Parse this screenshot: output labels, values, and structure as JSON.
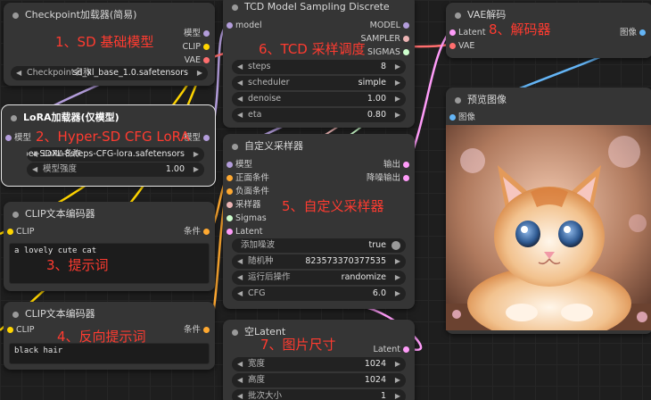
{
  "colors": {
    "clip": "#ffd500",
    "model": "#b39ddb",
    "vae": "#ff6e6e",
    "latent": "#ff9cf9",
    "conditioning": "#ffa931",
    "image": "#64b5f6",
    "sigmas": "#cdffcd",
    "sampler": "#ecb4b4",
    "noise": "#b0b0b0",
    "annotation": "#ff3b30"
  },
  "checkpoint": {
    "title": "Checkpoint加载器(简易)",
    "out_model": "模型",
    "out_clip": "CLIP",
    "out_vae": "VAE",
    "ckpt_name": "Checkpoint名称",
    "ckpt_value": "sd_xl_base_1.0.safetensors"
  },
  "lora": {
    "title": "LoRA加载器(仅模型)",
    "in_model": "模型",
    "out_model": "模型",
    "lora_name": "LoRA名称",
    "lora_value": "Hyper-SDXL-8steps-CFG-lora.safetensors",
    "strength_label": "模型强度",
    "strength_value": "1.00"
  },
  "clip_pos": {
    "title": "CLIP文本编码器",
    "in_clip": "CLIP",
    "out_cond": "条件",
    "text": "a lovely cute cat"
  },
  "clip_neg": {
    "title": "CLIP文本编码器",
    "in_clip": "CLIP",
    "out_cond": "条件",
    "text": "black hair"
  },
  "tcd": {
    "title": "TCD Model Sampling Discrete",
    "in_model": "model",
    "out_model": "MODEL",
    "out_sampler": "SAMPLER",
    "out_sigmas": "SIGMAS",
    "widgets": [
      {
        "name": "steps",
        "value": "8"
      },
      {
        "name": "scheduler",
        "value": "simple"
      },
      {
        "name": "denoise",
        "value": "1.00"
      },
      {
        "name": "eta",
        "value": "0.80"
      }
    ]
  },
  "custom_sampler": {
    "title": "自定义采样器",
    "inputs": [
      "模型",
      "正面条件",
      "负面条件",
      "采样器",
      "Sigmas",
      "Latent"
    ],
    "out_output": "输出",
    "out_denoised": "降噪输出",
    "add_noise_label": "添加噪波",
    "add_noise_value": "true",
    "seed_label": "随机种",
    "seed_value": "823573370377535",
    "control_label": "运行后操作",
    "control_value": "randomize",
    "cfg_label": "CFG",
    "cfg_value": "6.0"
  },
  "empty_latent": {
    "title": "空Latent",
    "out_latent": "Latent",
    "width_label": "宽度",
    "width_value": "1024",
    "height_label": "高度",
    "height_value": "1024",
    "batch_label": "批次大小",
    "batch_value": "1"
  },
  "vae_decode": {
    "title": "VAE解码",
    "in_latent": "Latent",
    "in_vae": "VAE",
    "out_image": "图像"
  },
  "preview": {
    "title": "预览图像",
    "in_image": "图像"
  },
  "annotations": {
    "a1": "1、SD 基础模型",
    "a2": "2、Hyper-SD CFG LoRA",
    "a3": "3、提示词",
    "a4": "4、反向提示词",
    "a5": "5、自定义采样器",
    "a6": "6、TCD 采样调度",
    "a7": "7、图片尺寸",
    "a8": "8、解码器"
  }
}
